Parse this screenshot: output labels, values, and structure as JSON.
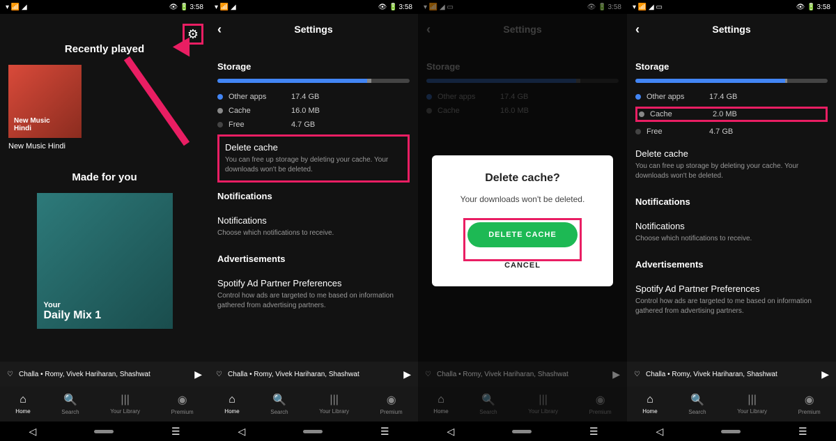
{
  "status": {
    "time": "3:58"
  },
  "screen1": {
    "recently_played": "Recently played",
    "album_text1": "New Music",
    "album_text2": "Hindi",
    "album_title": "New Music Hindi",
    "made_for_you": "Made for you",
    "mix_line1": "Your",
    "mix_line2": "Daily Mix 1"
  },
  "settings": {
    "title": "Settings",
    "storage": "Storage",
    "other_apps": "Other apps",
    "other_apps_val": "17.4 GB",
    "cache": "Cache",
    "cache_val_before": "16.0 MB",
    "cache_val_after": "2.0 MB",
    "free": "Free",
    "free_val": "4.7 GB",
    "delete_cache": "Delete cache",
    "delete_cache_desc": "You can free up storage by deleting your cache. Your downloads won't be deleted.",
    "notifications_head": "Notifications",
    "notifications": "Notifications",
    "notifications_desc": "Choose which notifications to receive.",
    "ads_head": "Advertisements",
    "ads_title": "Spotify Ad Partner Preferences",
    "ads_desc": "Control how ads are targeted to me based on information gathered from advertising partners."
  },
  "dialog": {
    "title": "Delete cache?",
    "msg": "Your downloads won't be deleted.",
    "primary": "DELETE CACHE",
    "cancel": "CANCEL"
  },
  "nowplaying": "Challa • Romy, Vivek Hariharan, Shashwat",
  "nav": {
    "home": "Home",
    "search": "Search",
    "library": "Your Library",
    "premium": "Premium"
  }
}
